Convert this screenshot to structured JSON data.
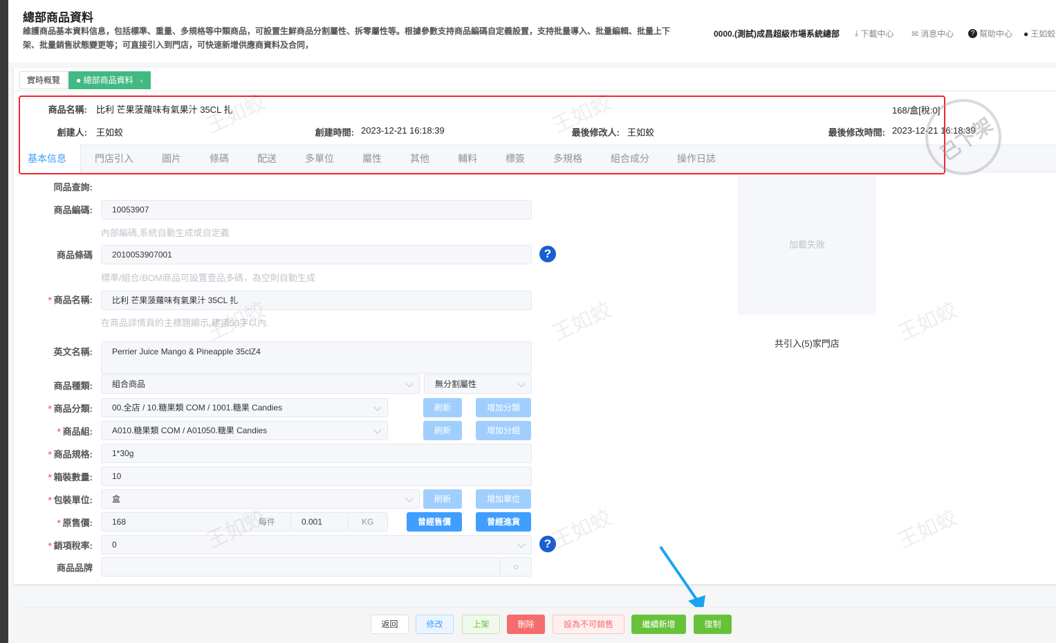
{
  "header": {
    "title": "總部商品資料",
    "description": "維護商品基本資料信息，包括標準、重量、多規格等中類商品，可設置生鮮商品分割屬性、拆零屬性等。根據參數支持商品編碼自定義設置，支持批量導入、批量編輯、批量上下架、批量銷售狀態變更等；可直接引入到門店，可快速新增供應商資料及合同，",
    "org": "0000.(測試)成昌超級市場系統總部",
    "download": "下載中心",
    "messages": "消息中心",
    "help": "幫助中心",
    "user": "王如蛟"
  },
  "tabs": [
    {
      "label": "實時概覽"
    },
    {
      "label": "總部商品資料",
      "close": "×"
    }
  ],
  "info": {
    "name_label": "商品名稱:",
    "name": "比利 芒果菠蘿味有氣果汁 35CL 扎",
    "price": "168/盒[稅:0]",
    "creator_label": "創建人:",
    "creator": "王如蛟",
    "created_label": "創建時間:",
    "created": "2023-12-21 16:18:39",
    "modifier_label": "最後修改人:",
    "modifier": "王如蛟",
    "modified_label": "最後修改時間:",
    "modified": "2023-12-21 16:18:39"
  },
  "subtabs": [
    "基本信息",
    "門店引入",
    "圖片",
    "條碼",
    "配送",
    "多單位",
    "屬性",
    "其他",
    "輔料",
    "標簽",
    "多規格",
    "組合成分",
    "操作日誌"
  ],
  "form": {
    "same_query": "同品查詢:",
    "code_label": "商品編碼:",
    "code": "10053907",
    "code_hint": "內部編碼,系統自動生成或自定義",
    "barcode_label": "商品條碼",
    "barcode": "2010053907001",
    "barcode_hint": "標準/組合/BOM商品可設置壹品多碼，為空則自動生成",
    "name_label": "商品名稱:",
    "name": "比利 芒果菠蘿味有氣果汁 35CL 扎",
    "name_hint": "在商品詳情頁的主標題顯示,建議50字以內.",
    "en_label": "英文名稱:",
    "en": "Perrier Juice Mango & Pineapple 35clZ4",
    "type_label": "商品種類:",
    "type": "組合商品",
    "split": "無分割屬性",
    "cat_label": "商品分類:",
    "cat": "00.全店 / 10.糖果類 COM / 1001.糖果 Candies",
    "refresh": "刷新",
    "add_cat": "增加分類",
    "group_label": "商品組:",
    "group": "A010.糖果類 COM / A01050.糖果 Candies",
    "add_group": "增加分組",
    "spec_label": "商品規格:",
    "spec": "1*30g",
    "box_label": "箱裝數量:",
    "box": "10",
    "unit_label": "包裝單位:",
    "unit": "盒",
    "add_unit": "增加單位",
    "price_label": "原售價:",
    "price": "168",
    "per": "每件",
    "weight": "0.001",
    "kg": "KG",
    "past_sale": "曾經售價",
    "past_purchase": "曾經進貨",
    "tax_label": "銷項稅率:",
    "tax": "0",
    "brand_label": "商品品牌",
    "brand": ""
  },
  "image": {
    "failed": "加載失敗",
    "stores": "共引入(5)家門店"
  },
  "stamp": "已下架",
  "watermark": "王如蛟",
  "footer": {
    "back": "返回",
    "edit": "修改",
    "shelve": "上架",
    "delete": "刪除",
    "unsellable": "設為不可銷售",
    "continue_add": "繼續新增",
    "copy": "復制"
  }
}
